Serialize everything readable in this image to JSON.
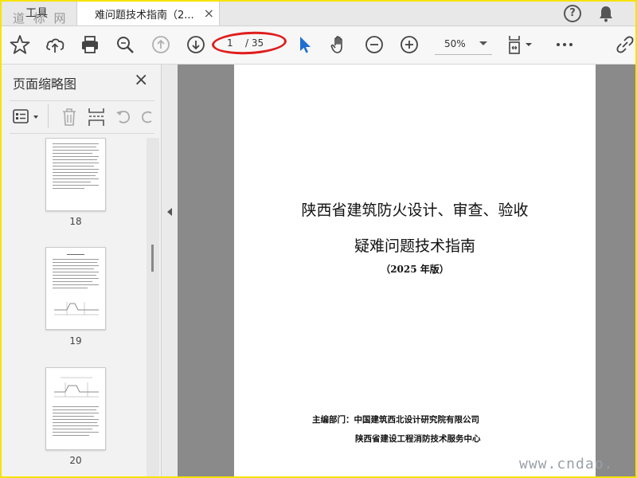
{
  "tabs": {
    "tools_label": "工具",
    "document_label": "难问题技术指南（2...",
    "close_glyph": "×"
  },
  "watermark_top": "道 标 网",
  "help_glyph": "?",
  "toolbar": {
    "current_page": "1",
    "total_pages": "/ 35",
    "zoom": "50%",
    "icons": [
      "star-icon",
      "cloud-upload-icon",
      "print-icon",
      "zoom-search-icon",
      "page-up-icon",
      "page-down-icon",
      "select-cursor-icon",
      "hand-tool-icon",
      "zoom-out-icon",
      "zoom-in-icon",
      "fit-page-icon",
      "more-icon",
      "share-link-icon"
    ]
  },
  "panel": {
    "title": "页面缩略图",
    "close_glyph": "×",
    "thumbnails": [
      {
        "page_label": "18"
      },
      {
        "page_label": "19"
      },
      {
        "page_label": "20"
      }
    ]
  },
  "document": {
    "title_line1": "陕西省建筑防火设计、审查、验收",
    "title_line2": "疑难问题技术指南",
    "edition": "（2025 年版）",
    "org_line1": "主编部门：中国建筑西北设计研究院有限公司",
    "org_line2": "陕西省建设工程消防技术服务中心"
  },
  "site_watermark": "www.cndao.",
  "colors": {
    "frame": "#f5e300",
    "highlight_ellipse": "#e01d1d",
    "accent_cursor": "#1f6fd1",
    "viewer_bg": "#8a8a8a"
  }
}
